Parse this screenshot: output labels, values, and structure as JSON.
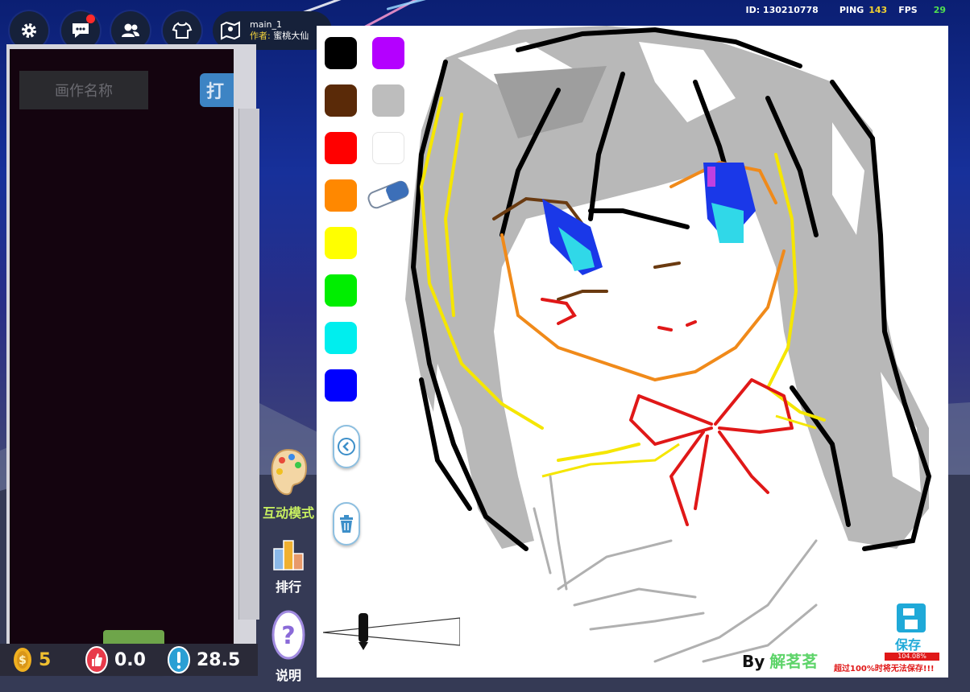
{
  "topbar": {
    "buttons": [
      {
        "icon": "gear-icon"
      },
      {
        "icon": "chat-icon",
        "badge": true
      },
      {
        "icon": "friends-icon"
      },
      {
        "icon": "wardrobe-icon"
      }
    ],
    "map": {
      "name": "main_1",
      "author_label": "作者:",
      "author_name": "蜜桃大仙"
    },
    "stats": {
      "id_text": "ID: 130210778",
      "ping_label": "PING",
      "ping_value": "143",
      "fps_label": "FPS",
      "fps_value": "29"
    }
  },
  "left_panel": {
    "name_placeholder": "画作名称",
    "open_button_label": "打",
    "add_button_label": "+"
  },
  "bottom_stats": {
    "coins": "5",
    "likes": "0.0",
    "alert_value": "28.5"
  },
  "side_actions": {
    "interactive_mode": "互动模式",
    "ranking": "排行",
    "help": "说明"
  },
  "palette": {
    "left_colors": [
      "#000000",
      "#5a2a08",
      "#ff0000",
      "#ff8800",
      "#ffff00",
      "#00ee00",
      "#00eeee",
      "#0000ff"
    ],
    "right_colors": [
      "#b400ff",
      "#bdbdbd",
      "#ffffff"
    ]
  },
  "canvas": {
    "signature_prefix": "By",
    "signature_name": "解茗茗",
    "save_label": "保存",
    "capacity_text": "104.08%",
    "capacity_fraction": 1.0,
    "warning_text": "超过100%时将无法保存!!!"
  }
}
